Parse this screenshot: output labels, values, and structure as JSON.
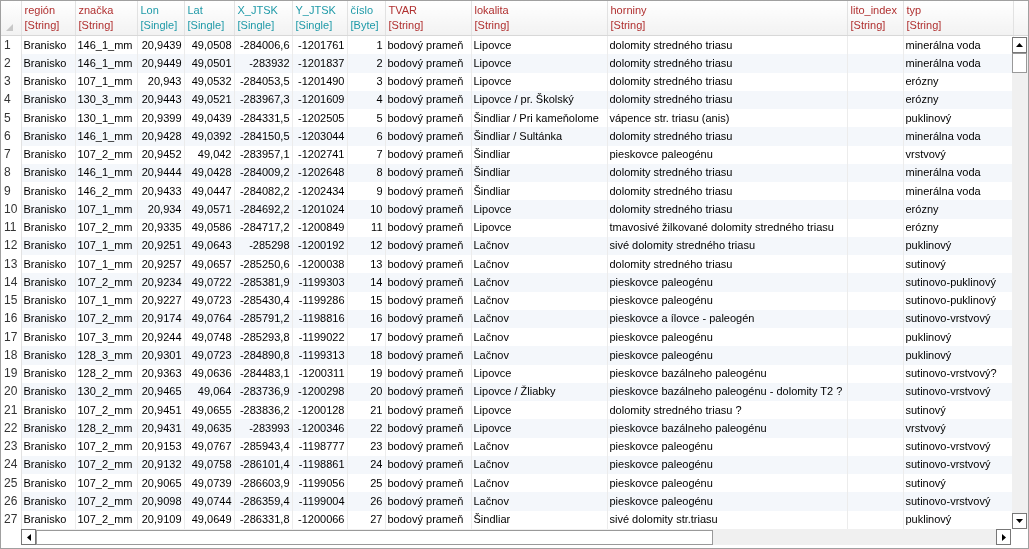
{
  "table": {
    "columns": [
      {
        "name": "región",
        "type": "[String]",
        "kind": "text"
      },
      {
        "name": "značka",
        "type": "[String]",
        "kind": "text"
      },
      {
        "name": "Lon",
        "type": "[Single]",
        "kind": "number"
      },
      {
        "name": "Lat",
        "type": "[Single]",
        "kind": "number"
      },
      {
        "name": "X_JTSK",
        "type": "[Single]",
        "kind": "number"
      },
      {
        "name": "Y_JTSK",
        "type": "[Single]",
        "kind": "number"
      },
      {
        "name": "číslo",
        "type": "[Byte]",
        "kind": "number"
      },
      {
        "name": "TVAR",
        "type": "[String]",
        "kind": "text"
      },
      {
        "name": "lokalita",
        "type": "[String]",
        "kind": "text"
      },
      {
        "name": "horniny",
        "type": "[String]",
        "kind": "text"
      },
      {
        "name": "lito_index",
        "type": "[String]",
        "kind": "text"
      },
      {
        "name": "typ",
        "type": "[String]",
        "kind": "text"
      }
    ],
    "rows": [
      {
        "number": "1",
        "cells": [
          "Branisko",
          "146_1_mm",
          "20,9439",
          "49,0508",
          "-284006,6",
          "-1201761",
          "1",
          "bodový prameň",
          "Lipovce",
          "dolomity stredného triasu",
          null,
          "minerálna voda"
        ]
      },
      {
        "number": "2",
        "cells": [
          "Branisko",
          "146_1_mm",
          "20,9449",
          "49,0501",
          "-283932",
          "-1201837",
          "2",
          "bodový prameň",
          "Lipovce",
          "dolomity stredného triasu",
          null,
          "minerálna voda"
        ]
      },
      {
        "number": "3",
        "cells": [
          "Branisko",
          "107_1_mm",
          "20,943",
          "49,0532",
          "-284053,5",
          "-1201490",
          "3",
          "bodový prameň",
          "Lipovce",
          "dolomity stredného triasu",
          null,
          "erózny"
        ]
      },
      {
        "number": "4",
        "cells": [
          "Branisko",
          "130_3_mm",
          "20,9443",
          "49,0521",
          "-283967,3",
          "-1201609",
          "4",
          "bodový prameň",
          "Lipovce / pr. Školský",
          "dolomity stredného triasu",
          null,
          "erózny"
        ]
      },
      {
        "number": "5",
        "cells": [
          "Branisko",
          "130_1_mm",
          "20,9399",
          "49,0439",
          "-284331,5",
          "-1202505",
          "5",
          "bodový prameň",
          "Šindliar / Pri kameňolome",
          "vápence str. triasu (anis)",
          null,
          "puklinový"
        ]
      },
      {
        "number": "6",
        "cells": [
          "Branisko",
          "146_1_mm",
          "20,9428",
          "49,0392",
          "-284150,5",
          "-1203044",
          "6",
          "bodový prameň",
          "Šindliar / Sultánka",
          "dolomity stredného triasu",
          null,
          "minerálna voda"
        ]
      },
      {
        "number": "7",
        "cells": [
          "Branisko",
          "107_2_mm",
          "20,9452",
          "49,042",
          "-283957,1",
          "-1202741",
          "7",
          "bodový prameň",
          "Šindliar",
          "pieskovce paleogénu",
          null,
          "vrstvový"
        ]
      },
      {
        "number": "8",
        "cells": [
          "Branisko",
          "146_1_mm",
          "20,9444",
          "49,0428",
          "-284009,2",
          "-1202648",
          "8",
          "bodový prameň",
          "Šindliar",
          "dolomity stredného triasu",
          null,
          "minerálna voda"
        ]
      },
      {
        "number": "9",
        "cells": [
          "Branisko",
          "146_2_mm",
          "20,9433",
          "49,0447",
          "-284082,2",
          "-1202434",
          "9",
          "bodový prameň",
          "Šindliar",
          "dolomity stredného triasu",
          null,
          "minerálna voda"
        ]
      },
      {
        "number": "10",
        "cells": [
          "Branisko",
          "107_1_mm",
          "20,934",
          "49,0571",
          "-284692,2",
          "-1201024",
          "10",
          "bodový prameň",
          "Lipovce",
          "dolomity stredného triasu",
          null,
          "erózny"
        ]
      },
      {
        "number": "11",
        "cells": [
          "Branisko",
          "107_2_mm",
          "20,9335",
          "49,0586",
          "-284717,2",
          "-1200849",
          "11",
          "bodový prameň",
          "Lipovce",
          "tmavosivé žilkované dolomity stredného triasu",
          null,
          "erózny"
        ]
      },
      {
        "number": "12",
        "cells": [
          "Branisko",
          "107_1_mm",
          "20,9251",
          "49,0643",
          "-285298",
          "-1200192",
          "12",
          "bodový prameň",
          "Lačnov",
          "sivé dolomity stredného triasu",
          null,
          "puklinový"
        ]
      },
      {
        "number": "13",
        "cells": [
          "Branisko",
          "107_1_mm",
          "20,9257",
          "49,0657",
          "-285250,6",
          "-1200038",
          "13",
          "bodový prameň",
          "Lačnov",
          "dolomity stredného triasu",
          null,
          "sutinový"
        ]
      },
      {
        "number": "14",
        "cells": [
          "Branisko",
          "107_2_mm",
          "20,9234",
          "49,0722",
          "-285381,9",
          "-1199303",
          "14",
          "bodový prameň",
          "Lačnov",
          "pieskovce paleogénu",
          null,
          "sutinovo-puklinový"
        ]
      },
      {
        "number": "15",
        "cells": [
          "Branisko",
          "107_1_mm",
          "20,9227",
          "49,0723",
          "-285430,4",
          "-1199286",
          "15",
          "bodový prameň",
          "Lačnov",
          "pieskovce paleogénu",
          null,
          "sutinovo-puklinový"
        ]
      },
      {
        "number": "16",
        "cells": [
          "Branisko",
          "107_2_mm",
          "20,9174",
          "49,0764",
          "-285791,2",
          "-1198816",
          "16",
          "bodový prameň",
          "Lačnov",
          "pieskovce a ílovce - paleogén",
          null,
          "sutinovo-vrstvový"
        ]
      },
      {
        "number": "17",
        "cells": [
          "Branisko",
          "107_3_mm",
          "20,9244",
          "49,0748",
          "-285293,8",
          "-1199022",
          "17",
          "bodový prameň",
          "Lačnov",
          "pieskovce paleogénu",
          null,
          "puklinový"
        ]
      },
      {
        "number": "18",
        "cells": [
          "Branisko",
          "128_3_mm",
          "20,9301",
          "49,0723",
          "-284890,8",
          "-1199313",
          "18",
          "bodový prameň",
          "Lačnov",
          "pieskovce paleogénu",
          null,
          "puklinový"
        ]
      },
      {
        "number": "19",
        "cells": [
          "Branisko",
          "128_2_mm",
          "20,9363",
          "49,0636",
          "-284483,1",
          "-1200311",
          "19",
          "bodový prameň",
          "Lipovce",
          "pieskovce bazálneho paleogénu",
          null,
          "sutinovo-vrstvový?"
        ]
      },
      {
        "number": "20",
        "cells": [
          "Branisko",
          "130_2_mm",
          "20,9465",
          "49,064",
          "-283736,9",
          "-1200298",
          "20",
          "bodový prameň",
          "Lipovce / Žliabky",
          "pieskovce bazálneho paleogénu - dolomity T2 ?",
          null,
          "sutinovo-vrstvový"
        ]
      },
      {
        "number": "21",
        "cells": [
          "Branisko",
          "107_2_mm",
          "20,9451",
          "49,0655",
          "-283836,2",
          "-1200128",
          "21",
          "bodový prameň",
          "Lipovce",
          "dolomity stredného triasu ?",
          null,
          "sutinový"
        ]
      },
      {
        "number": "22",
        "cells": [
          "Branisko",
          "128_2_mm",
          "20,9431",
          "49,0635",
          "-283993",
          "-1200346",
          "22",
          "bodový prameň",
          "Lipovce",
          "pieskovce bazálneho paleogénu",
          null,
          "vrstvový"
        ]
      },
      {
        "number": "23",
        "cells": [
          "Branisko",
          "107_2_mm",
          "20,9153",
          "49,0767",
          "-285943,4",
          "-1198777",
          "23",
          "bodový prameň",
          "Lačnov",
          "pieskovce paleogénu",
          null,
          "sutinovo-vrstvový"
        ]
      },
      {
        "number": "24",
        "cells": [
          "Branisko",
          "107_2_mm",
          "20,9132",
          "49,0758",
          "-286101,4",
          "-1198861",
          "24",
          "bodový prameň",
          "Lačnov",
          "pieskovce paleogénu",
          null,
          "sutinovo-vrstvový"
        ]
      },
      {
        "number": "25",
        "cells": [
          "Branisko",
          "107_2_mm",
          "20,9065",
          "49,0739",
          "-286603,9",
          "-1199056",
          "25",
          "bodový prameň",
          "Lačnov",
          "pieskovce paleogénu",
          null,
          "sutinový"
        ]
      },
      {
        "number": "26",
        "cells": [
          "Branisko",
          "107_2_mm",
          "20,9098",
          "49,0744",
          "-286359,4",
          "-1199004",
          "26",
          "bodový prameň",
          "Lačnov",
          "pieskovce paleogénu",
          null,
          "sutinovo-vrstvový"
        ]
      },
      {
        "number": "27",
        "cells": [
          "Branisko",
          "107_2_mm",
          "20,9109",
          "49,0649",
          "-286331,8",
          "-1200066",
          "27",
          "bodový prameň",
          "Šindliar",
          "sivé dolomity str.triasu",
          null,
          "puklinový"
        ]
      }
    ]
  }
}
